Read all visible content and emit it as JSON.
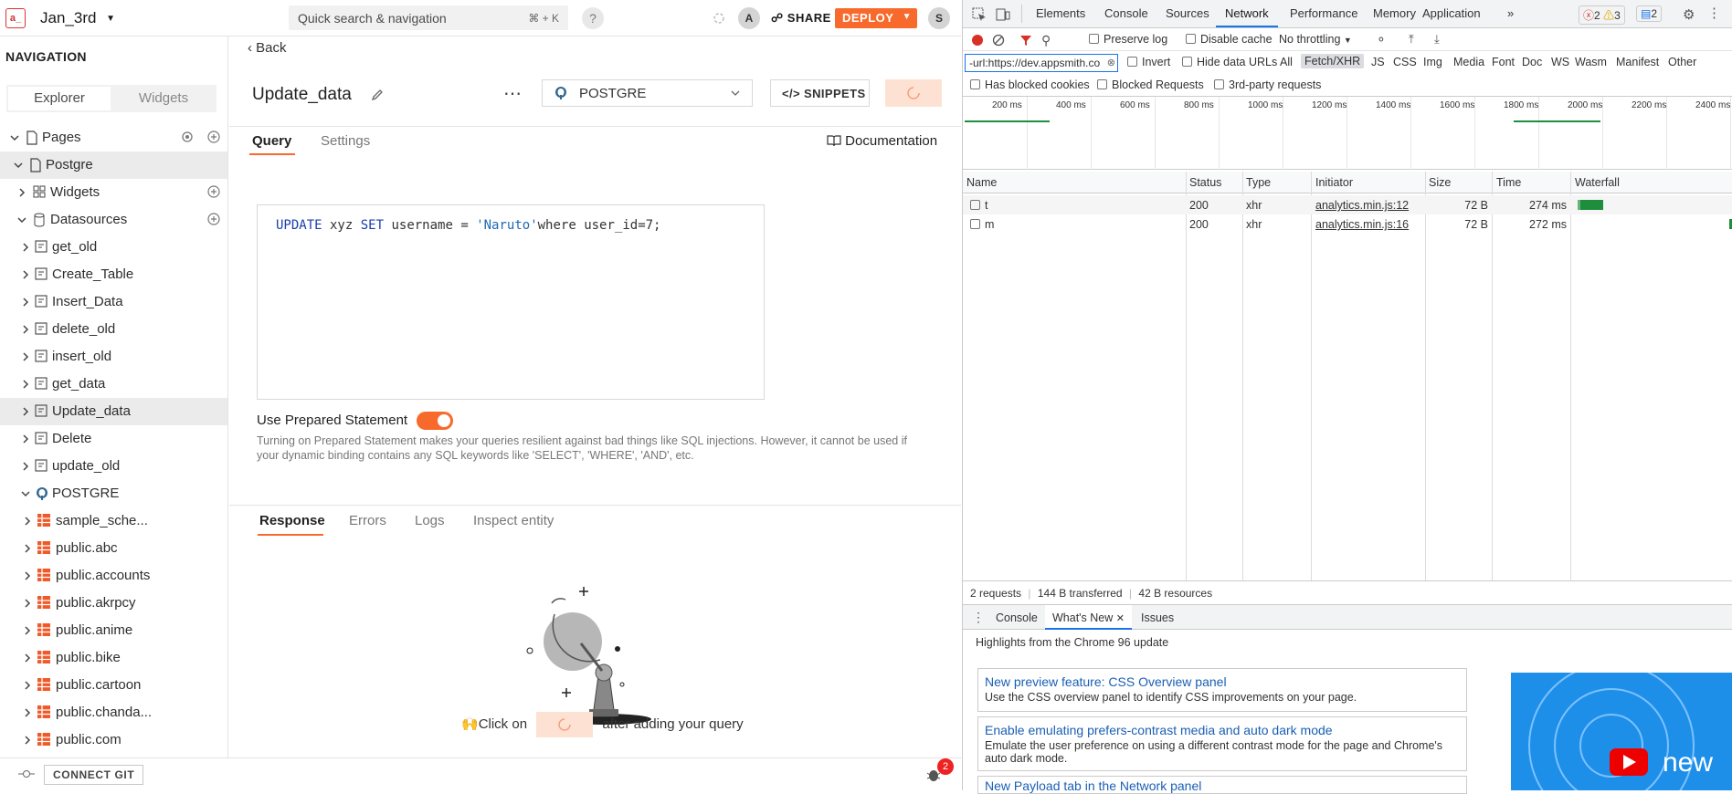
{
  "app": {
    "name": "Jan_3rd",
    "logo_text": "a_"
  },
  "topbar": {
    "search_placeholder": "Quick search & navigation",
    "search_shortcut": "⌘ + K",
    "help": "?",
    "avatar_a": "A",
    "share_label": "SHARE",
    "deploy_label": "DEPLOY",
    "avatar_s": "S"
  },
  "sidebar": {
    "title": "NAVIGATION",
    "tab_explorer": "Explorer",
    "tab_widgets": "Widgets",
    "pages_label": "Pages",
    "page_postgre": "Postgre",
    "widgets_label": "Widgets",
    "datasources_label": "Datasources",
    "queries": [
      "get_old",
      "Create_Table",
      "Insert_Data",
      "delete_old",
      "insert_old",
      "get_data",
      "Update_data",
      "Delete",
      "update_old"
    ],
    "datasource_name": "POSTGRE",
    "tables": [
      "sample_sche...",
      "public.abc",
      "public.accounts",
      "public.akrpcy",
      "public.anime",
      "public.bike",
      "public.cartoon",
      "public.chanda...",
      "public.com"
    ]
  },
  "bottombar": {
    "connect_git": "CONNECT GIT",
    "bug_count": "2"
  },
  "main": {
    "back_label": "Back",
    "query_name": "Update_data",
    "datasource_selected": "POSTGRE",
    "snippets_label": "SNIPPETS",
    "tab_query": "Query",
    "tab_settings": "Settings",
    "documentation_label": "Documentation",
    "sql": {
      "kw1": "UPDATE",
      "t1": " xyz ",
      "kw2": "SET",
      "t2": " username = ",
      "str": "'Naruto'",
      "t3": "where user_id=7;"
    },
    "prepared_label": "Use Prepared Statement",
    "prepared_on": true,
    "prepared_desc": "Turning on Prepared Statement makes your queries resilient against bad things like SQL injections. However, it cannot be used if your dynamic binding contains any SQL keywords like 'SELECT', 'WHERE', 'AND', etc.",
    "response_tabs": [
      "Response",
      "Errors",
      "Logs",
      "Inspect entity"
    ],
    "run_hint_before": "Click on",
    "run_hint_after": "after adding your query"
  },
  "devtools": {
    "tabs": [
      "Elements",
      "Console",
      "Sources",
      "Network",
      "Performance",
      "Memory",
      "Application"
    ],
    "errors": "2",
    "warnings": "3",
    "infos": "2",
    "preserve_log": "Preserve log",
    "disable_cache": "Disable cache",
    "throttling": "No throttling",
    "filter_value": "-url:https://dev.appsmith.co",
    "invert": "Invert",
    "hide_data_urls": "Hide data URLs",
    "filter_types": [
      "All",
      "Fetch/XHR",
      "JS",
      "CSS",
      "Img",
      "Media",
      "Font",
      "Doc",
      "WS",
      "Wasm",
      "Manifest",
      "Other"
    ],
    "has_blocked_cookies": "Has blocked cookies",
    "blocked_requests": "Blocked Requests",
    "third_party": "3rd-party requests",
    "timeline_ticks": [
      "200 ms",
      "400 ms",
      "600 ms",
      "800 ms",
      "1000 ms",
      "1200 ms",
      "1400 ms",
      "1600 ms",
      "1800 ms",
      "2000 ms",
      "2200 ms",
      "2400 ms"
    ],
    "columns": [
      "Name",
      "Status",
      "Type",
      "Initiator",
      "Size",
      "Time",
      "Waterfall"
    ],
    "requests": [
      {
        "name": "t",
        "status": "200",
        "type": "xhr",
        "initiator": "analytics.min.js:12",
        "size": "72 B",
        "time": "274 ms"
      },
      {
        "name": "m",
        "status": "200",
        "type": "xhr",
        "initiator": "analytics.min.js:16",
        "size": "72 B",
        "time": "272 ms"
      }
    ],
    "summary": {
      "requests": "2 requests",
      "transferred": "144 B transferred",
      "resources": "42 B resources"
    },
    "drawer_tabs": [
      "Console",
      "What's New",
      "Issues"
    ],
    "highlights_title": "Highlights from the Chrome 96 update",
    "cards": [
      {
        "title": "New preview feature: CSS Overview panel",
        "desc": "Use the CSS overview panel to identify CSS improvements on your page."
      },
      {
        "title": "Enable emulating prefers-contrast media and auto dark mode",
        "desc": "Emulate the user preference on using a different contrast mode for the page and Chrome's auto dark mode."
      },
      {
        "title": "New Payload tab in the Network panel",
        "desc": ""
      }
    ],
    "video_text": "new"
  }
}
